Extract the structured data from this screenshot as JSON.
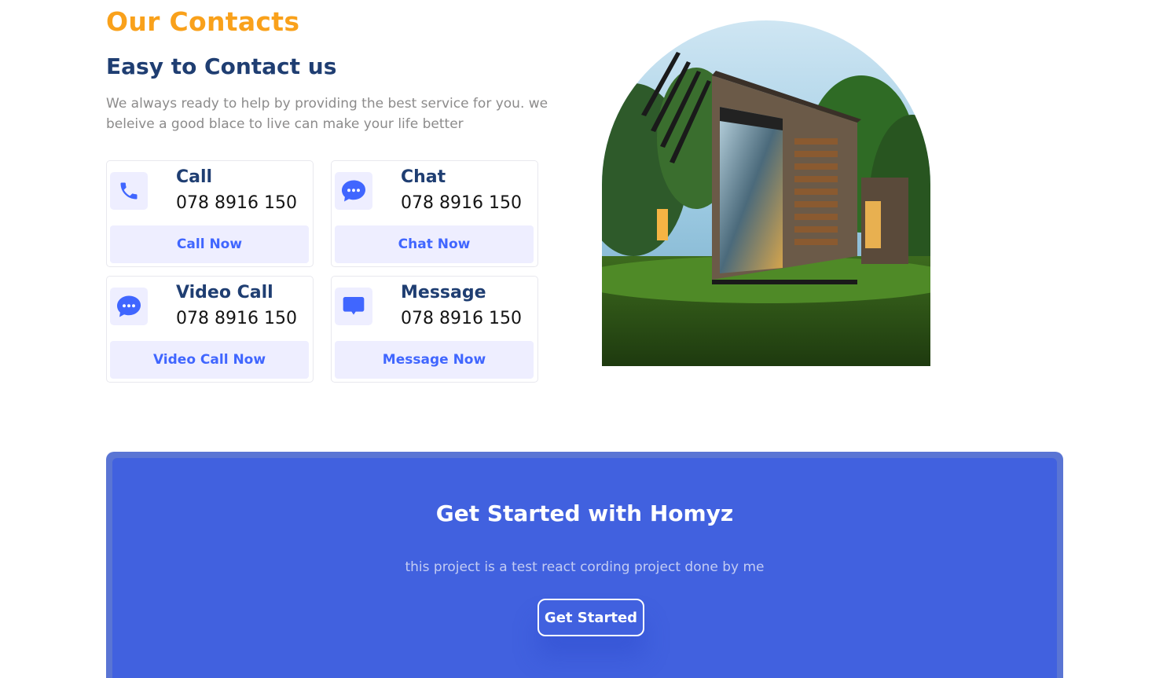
{
  "header": {
    "orange_title": "Our Contacts",
    "primary_title": "Easy to Contact us",
    "description": "We always ready to help by providing the best service for you. we beleive a good blace to live can make your life better"
  },
  "contacts": [
    {
      "title": "Call",
      "detail": "078 8916 150",
      "button": "Call Now",
      "icon": "phone-icon"
    },
    {
      "title": "Chat",
      "detail": "078 8916 150",
      "button": "Chat Now",
      "icon": "chat-bubble-dots-icon"
    },
    {
      "title": "Video Call",
      "detail": "078 8916 150",
      "button": "Video Call Now",
      "icon": "chat-bubble-dots-icon"
    },
    {
      "title": "Message",
      "detail": "078 8916 150",
      "button": "Message Now",
      "icon": "message-bubble-icon"
    }
  ],
  "image": {
    "subject": "modern container house in forest"
  },
  "cta": {
    "title": "Get Started with Homyz",
    "subtitle": "this project is a test react cording project done by me",
    "button": "Get Started"
  },
  "colors": {
    "accent_orange": "#f9a11b",
    "primary_navy": "#1f3e72",
    "link_blue": "#4066ff",
    "card_button_bg": "#eeeeff",
    "cta_bg": "#4161df",
    "cta_border": "#5a75d4"
  }
}
